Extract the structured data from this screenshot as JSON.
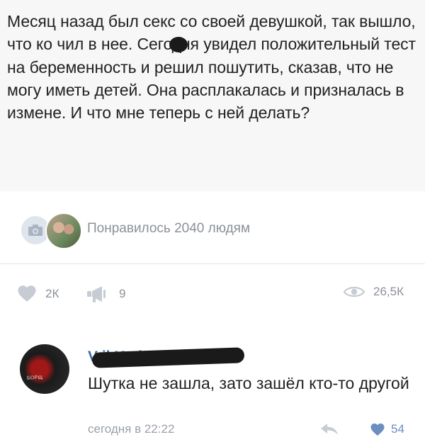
{
  "post": {
    "text": "Месяц назад был секс со своей девушкой, так вышло, что ко чил в нее. Сегодня увидел положительный тест на беременность и решил пошутить, сказав, что не могу иметь детей. Она расплакалась и призналась в измене. И что мне теперь с ней делать?"
  },
  "likes_summary": {
    "text": "Понравилось 2040 людям"
  },
  "stats": {
    "likes": "2К",
    "reposts": "9",
    "views": "26,5К"
  },
  "comment": {
    "author": "V  il   K  nko",
    "avatar_label": "БОРЩ",
    "text": "Шутка не зашла, зато зашёл кто-то другой",
    "time": "сегодня в 22:22",
    "likes": "54"
  },
  "icons": {
    "camera": "camera-icon",
    "heart": "heart-icon",
    "megaphone": "megaphone-icon",
    "eye": "eye-icon",
    "reply": "reply-arrow-icon"
  },
  "colors": {
    "muted": "#8b9099",
    "link": "#3b6ea8",
    "liked": "#6a8fc0"
  }
}
